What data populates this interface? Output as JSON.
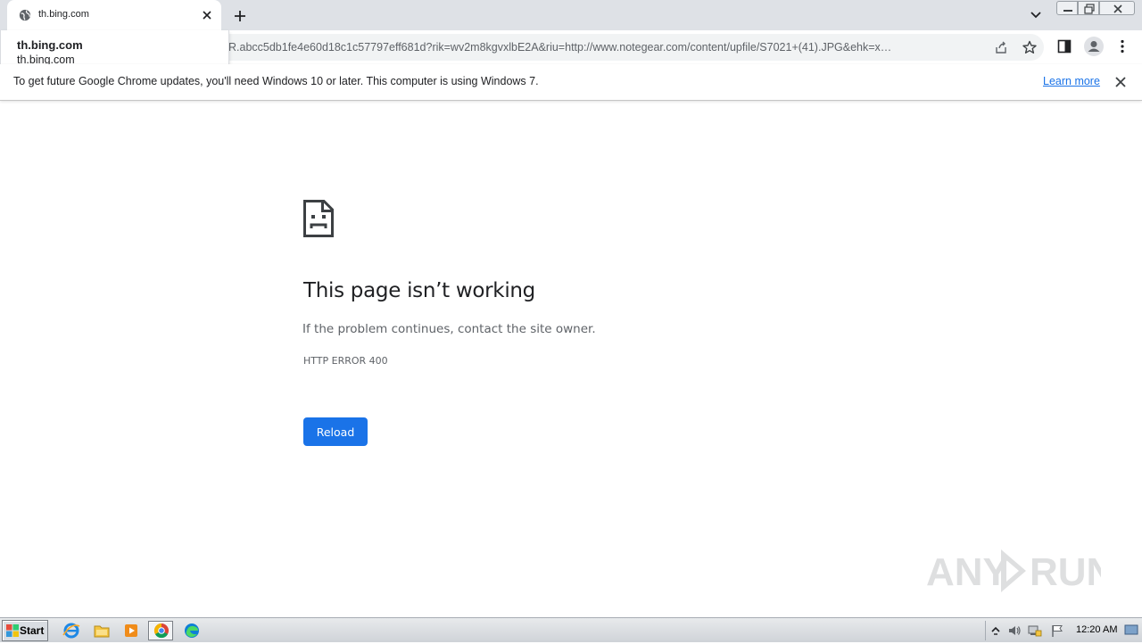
{
  "window": {
    "tab_title": "th.bing.com",
    "icons": [
      "globe-icon",
      "close-icon",
      "plus-icon",
      "chevron-down-icon",
      "minimize-icon",
      "restore-icon",
      "close-icon"
    ]
  },
  "toolbar": {
    "url": "R.abcc5db1fe4e60d18c1c57797eff681d?rik=wv2m8kgvxlbE2A&riu=http://www.notegear.com/content/upfile/S7021+(41).JPG&ehk=x…",
    "icons": [
      "share-icon",
      "star-icon",
      "side-panel-icon",
      "profile-icon",
      "more-menu-icon"
    ]
  },
  "suggestion": {
    "title": "th.bing.com",
    "subtitle": "th.bing.com"
  },
  "infobar": {
    "message": "To get future Google Chrome updates, you'll need Windows 10 or later. This computer is using Windows 7.",
    "link": "Learn more"
  },
  "error": {
    "icon": "sad-page-icon",
    "title": "This page isn’t working",
    "description": "If the problem continues, contact the site owner.",
    "code": "HTTP ERROR 400",
    "reload_label": "Reload"
  },
  "watermark": {
    "text_left": "ANY",
    "text_right": "RUN"
  },
  "taskbar": {
    "start_label": "Start",
    "apps": [
      "internet-explorer-icon",
      "file-explorer-icon",
      "media-player-icon",
      "chrome-icon",
      "edge-icon"
    ],
    "tray_icons": [
      "tray-expand-icon",
      "volume-icon",
      "network-icon",
      "action-center-flag-icon"
    ],
    "clock": "12:20 AM"
  },
  "colors": {
    "accent": "#1a73e8",
    "tabstrip": "#dee1e6",
    "text": "#202124",
    "subtext": "#5f6368"
  }
}
